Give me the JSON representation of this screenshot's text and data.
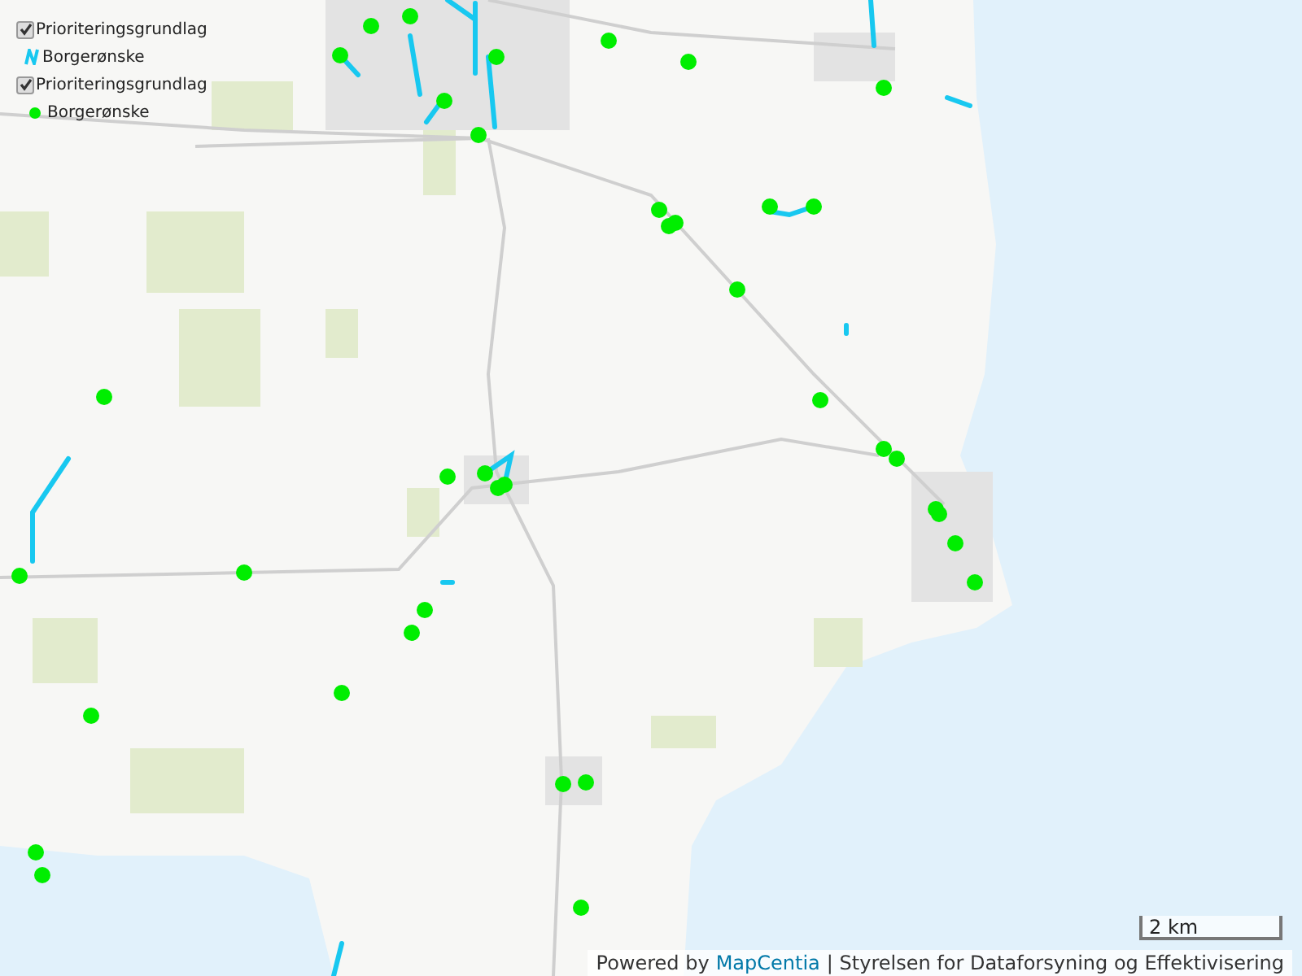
{
  "legend": [
    {
      "label": "Prioriteringsgrundlag",
      "checked": true,
      "children": [
        {
          "label": "Borgerønske",
          "kind": "line"
        }
      ]
    },
    {
      "label": "Prioriteringsgrundlag",
      "checked": true,
      "children": [
        {
          "label": "Borgerønske",
          "kind": "point"
        }
      ]
    }
  ],
  "scale_bar": {
    "label": "2 km"
  },
  "attribution": {
    "prefix": "Powered by",
    "link": "MapCentia",
    "suffix": "| Styrelsen for Dataforsyning og Effektivisering"
  }
}
